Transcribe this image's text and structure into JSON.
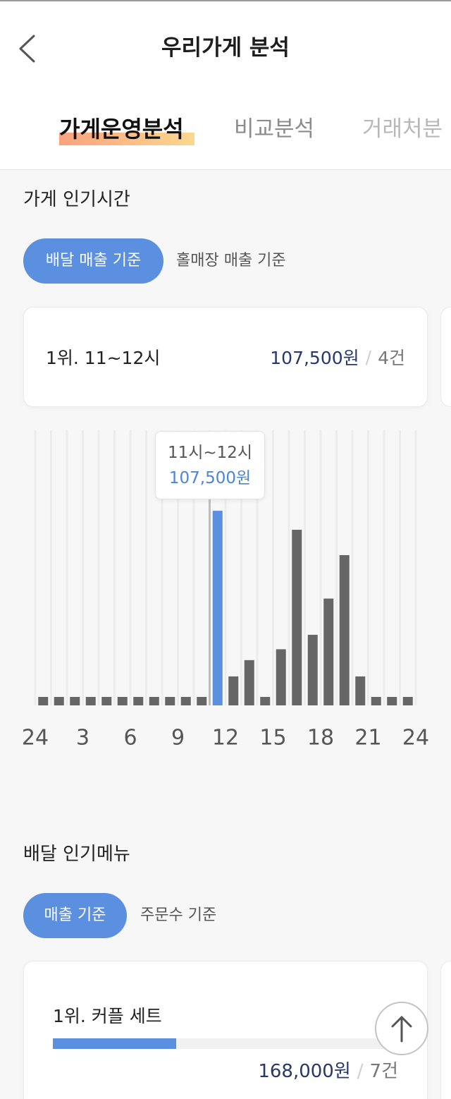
{
  "header": {
    "title": "우리가게 분석",
    "back_icon": "chevron-left-icon"
  },
  "tabs": [
    {
      "label": "가게운영분석",
      "active": true
    },
    {
      "label": "비교분석",
      "active": false
    },
    {
      "label": "거래처분",
      "active": false
    }
  ],
  "popular_time": {
    "title": "가게 인기시간",
    "filters": [
      {
        "label": "배달 매출 기준",
        "active": true
      },
      {
        "label": "홀매장 매출 기준",
        "active": false
      }
    ],
    "top_card": {
      "rank_label": "1위. 11~12시",
      "amount": "107,500원",
      "separator": "/",
      "count": "4건"
    },
    "tooltip": {
      "time": "11시~12시",
      "value": "107,500원"
    }
  },
  "chart_data": {
    "type": "bar",
    "x": [
      0,
      1,
      2,
      3,
      4,
      5,
      6,
      7,
      8,
      9,
      10,
      11,
      12,
      13,
      14,
      15,
      16,
      17,
      18,
      19,
      20,
      21,
      22,
      23
    ],
    "values": [
      0,
      0,
      0,
      0,
      0,
      0,
      0,
      0,
      0,
      0,
      0,
      107500,
      16000,
      25000,
      0,
      31000,
      97000,
      39000,
      59000,
      83000,
      16000,
      0,
      0,
      0
    ],
    "x_tick_values": [
      0,
      3,
      6,
      9,
      12,
      15,
      18,
      21,
      24
    ],
    "x_tick_labels": [
      "24",
      "3",
      "6",
      "9",
      "12",
      "15",
      "18",
      "21",
      "24"
    ],
    "xlim": [
      0,
      24
    ],
    "ylim": [
      0,
      150000
    ],
    "grid": true,
    "highlight_x": 11
  },
  "popular_menu": {
    "title": "배달 인기메뉴",
    "filters": [
      {
        "label": "매출 기준",
        "active": true
      },
      {
        "label": "주문수 기준",
        "active": false
      }
    ],
    "top_item": {
      "rank_label": "1위. 커플 세트",
      "share": 0.35,
      "amount": "168,000원",
      "separator": "/",
      "count": "7건"
    }
  },
  "scroll_top": {
    "icon": "arrow-up-icon"
  },
  "colors": {
    "accent": "#5b8fe0",
    "amount_text": "#27386b",
    "tooltip_value": "#4a86d8",
    "bar": "#666666",
    "grid": "#ececec",
    "pointer": "#bdbdbd",
    "axis_label": "#555555",
    "tab_highlight_from": "#fba27d",
    "tab_highlight_to": "#fcd88e",
    "background": "#f7f7f7"
  }
}
